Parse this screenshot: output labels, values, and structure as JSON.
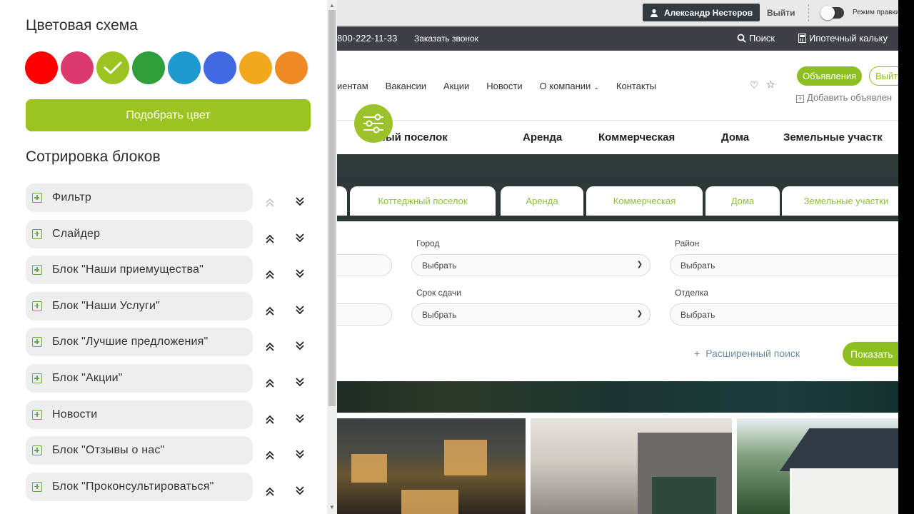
{
  "panel": {
    "color_scheme_title": "Цветовая схема",
    "colors": [
      "#ff0000",
      "#dc3a6e",
      "#9bc423",
      "#2f9e3b",
      "#1e9ad0",
      "#4169e1",
      "#f2a81d",
      "#f08a24"
    ],
    "selected_color_index": 2,
    "pick_color_label": "Подобрать цвет",
    "sort_title": "Сотрировка блоков",
    "blocks": [
      {
        "label": "Фильтр",
        "up_disabled": true
      },
      {
        "label": "Слайдер",
        "up_disabled": false
      },
      {
        "label": "Блок \"Наши приемущества\"",
        "up_disabled": false
      },
      {
        "label": "Блок \"Наши Услуги\"",
        "up_disabled": false
      },
      {
        "label": "Блок \"Лучшие предложения\"",
        "up_disabled": false
      },
      {
        "label": "Блок \"Акции\"",
        "up_disabled": false
      },
      {
        "label": "Новости",
        "up_disabled": false
      },
      {
        "label": "Блок \"Отзывы о нас\"",
        "up_disabled": false
      },
      {
        "label": "Блок \"Проконсультироваться\"",
        "up_disabled": false
      }
    ]
  },
  "adminbar": {
    "user": "Александр Нестеров",
    "logout": "Выйти",
    "edit_mode": "Режим правки"
  },
  "topbar": {
    "phone": "800-222-11-33",
    "callback": "Заказать звонок",
    "search": "Поиск",
    "calculator": "Ипотечный кальку"
  },
  "header": {
    "nav": [
      "иентам",
      "Вакансии",
      "Акции",
      "Новости",
      "О компании",
      "Контакты"
    ],
    "ads_button": "Объявления",
    "ads_button2": "Выйт",
    "add_ad": "Добавить объявлен"
  },
  "catmenu": [
    "ежный поселок",
    "Аренда",
    "Коммерческая",
    "Дома",
    "Земельные участк"
  ],
  "tabs": [
    "Коттеджный поселок",
    "Аренда",
    "Коммерческая",
    "Дома",
    "Земельные участки"
  ],
  "filter": {
    "city_label": "Город",
    "district_label": "Район",
    "deadline_label": "Срок сдачи",
    "finishing_label": "Отделка",
    "select_placeholder": "Выбрать",
    "advanced_search": "Расширенный поиск",
    "show_button": "Показать"
  }
}
